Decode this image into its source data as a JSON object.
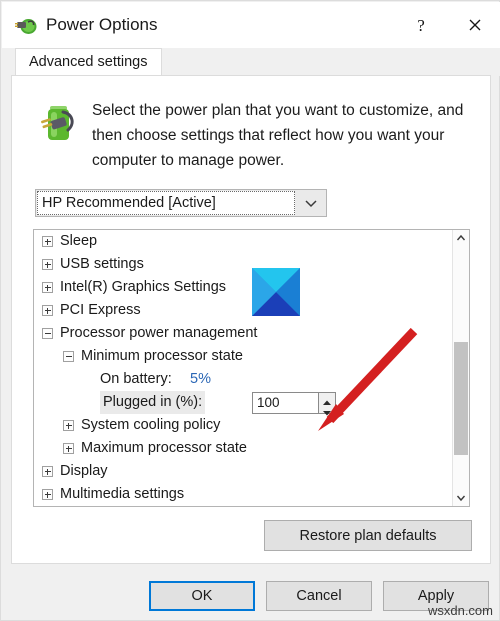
{
  "window": {
    "title": "Power Options",
    "icon": "power-plug-battery-icon",
    "help_label": "?",
    "close_label": "✕"
  },
  "tabs": [
    {
      "label": "Advanced settings",
      "active": true
    }
  ],
  "header": {
    "icon": "battery-plug-icon",
    "description": "Select the power plan that you want to customize, and then choose settings that reflect how you want your computer to manage power."
  },
  "plan_select": {
    "value": "HP Recommended [Active]",
    "options": [
      "HP Recommended [Active]"
    ],
    "chevron": "chevron-down-icon"
  },
  "tree": {
    "rows": [
      {
        "level": 0,
        "expander": "plus",
        "label": "Sleep"
      },
      {
        "level": 0,
        "expander": "plus",
        "label": "USB settings"
      },
      {
        "level": 0,
        "expander": "plus",
        "label": "Intel(R) Graphics Settings",
        "badge": "intel-graphics-icon"
      },
      {
        "level": 0,
        "expander": "plus",
        "label": "PCI Express"
      },
      {
        "level": 0,
        "expander": "minus",
        "label": "Processor power management"
      },
      {
        "level": 1,
        "expander": "minus",
        "label": "Minimum processor state"
      },
      {
        "level": 2,
        "expander": "none",
        "label": "On battery:",
        "value": "5%",
        "value_is_link": true
      },
      {
        "level": 2,
        "expander": "none",
        "label": "Plugged in (%):",
        "highlight": true,
        "spinner": "100"
      },
      {
        "level": 1,
        "expander": "plus",
        "label": "System cooling policy"
      },
      {
        "level": 1,
        "expander": "plus",
        "label": "Maximum processor state"
      },
      {
        "level": 0,
        "expander": "plus",
        "label": "Display"
      },
      {
        "level": 0,
        "expander": "plus",
        "label": "Multimedia settings"
      }
    ],
    "scrollbar": {
      "up_icon": "chevron-up-icon",
      "down_icon": "chevron-down-icon"
    }
  },
  "buttons": {
    "restore": "Restore plan defaults",
    "ok": "OK",
    "cancel": "Cancel",
    "apply": "Apply"
  },
  "annotation": {
    "arrow": "red-pointer-arrow",
    "color": "#d42020",
    "points_at": "plugged-in-spinner"
  },
  "watermark": "wsxdn.com",
  "colors": {
    "accent": "#0078d7",
    "link": "#2a66b5",
    "dialog_bg": "#f0f0f0",
    "panel_bg": "#ffffff",
    "button_bg": "#e1e1e1",
    "annotation_red": "#d42020"
  }
}
